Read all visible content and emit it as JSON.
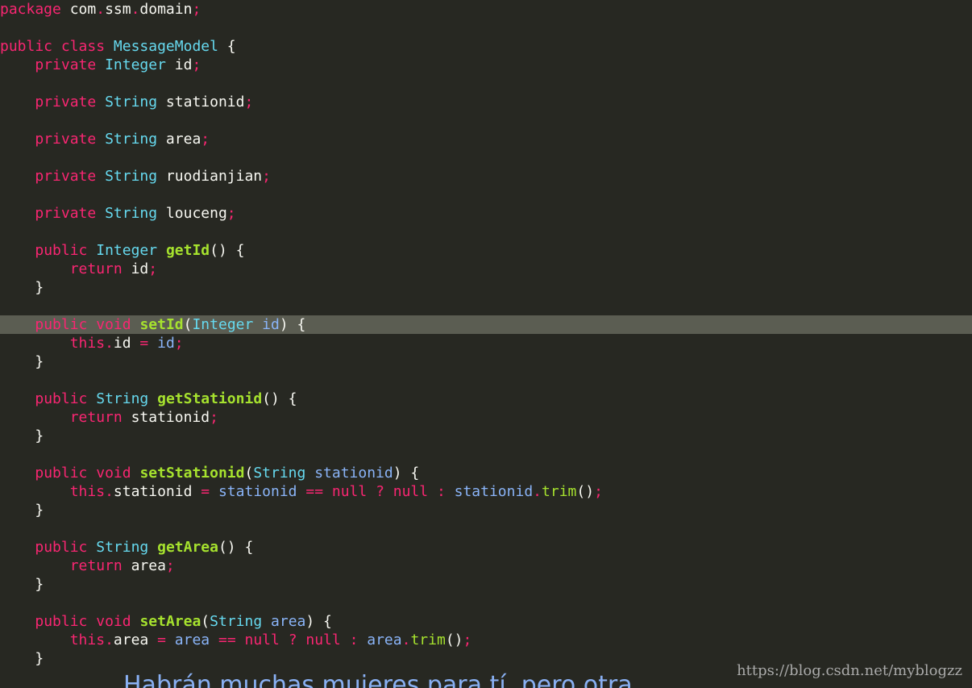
{
  "editor": {
    "theme": {
      "background": "#272822",
      "highlight_line_bg": "#5b5d52",
      "keyword": "#f92672",
      "type": "#66d9ef",
      "function": "#a6e22e",
      "param": "#8ab4f8",
      "text": "#f8f8f2"
    },
    "highlighted_line_index": 17,
    "lines": [
      [
        {
          "t": "package",
          "k": "kw"
        },
        {
          "t": " com",
          "k": "text"
        },
        {
          "t": ".",
          "k": "punct"
        },
        {
          "t": "ssm",
          "k": "text"
        },
        {
          "t": ".",
          "k": "punct"
        },
        {
          "t": "domain",
          "k": "text"
        },
        {
          "t": ";",
          "k": "punct"
        }
      ],
      [],
      [
        {
          "t": "public",
          "k": "kw"
        },
        {
          "t": " ",
          "k": "text"
        },
        {
          "t": "class",
          "k": "kw"
        },
        {
          "t": " ",
          "k": "text"
        },
        {
          "t": "MessageModel",
          "k": "type"
        },
        {
          "t": " {",
          "k": "text"
        }
      ],
      [
        {
          "t": "    ",
          "k": "text"
        },
        {
          "t": "private",
          "k": "kw"
        },
        {
          "t": " ",
          "k": "text"
        },
        {
          "t": "Integer",
          "k": "type"
        },
        {
          "t": " id",
          "k": "text"
        },
        {
          "t": ";",
          "k": "punct"
        }
      ],
      [],
      [
        {
          "t": "    ",
          "k": "text"
        },
        {
          "t": "private",
          "k": "kw"
        },
        {
          "t": " ",
          "k": "text"
        },
        {
          "t": "String",
          "k": "type"
        },
        {
          "t": " stationid",
          "k": "text"
        },
        {
          "t": ";",
          "k": "punct"
        }
      ],
      [],
      [
        {
          "t": "    ",
          "k": "text"
        },
        {
          "t": "private",
          "k": "kw"
        },
        {
          "t": " ",
          "k": "text"
        },
        {
          "t": "String",
          "k": "type"
        },
        {
          "t": " area",
          "k": "text"
        },
        {
          "t": ";",
          "k": "punct"
        }
      ],
      [],
      [
        {
          "t": "    ",
          "k": "text"
        },
        {
          "t": "private",
          "k": "kw"
        },
        {
          "t": " ",
          "k": "text"
        },
        {
          "t": "String",
          "k": "type"
        },
        {
          "t": " ruodianjian",
          "k": "text"
        },
        {
          "t": ";",
          "k": "punct"
        }
      ],
      [],
      [
        {
          "t": "    ",
          "k": "text"
        },
        {
          "t": "private",
          "k": "kw"
        },
        {
          "t": " ",
          "k": "text"
        },
        {
          "t": "String",
          "k": "type"
        },
        {
          "t": " louceng",
          "k": "text"
        },
        {
          "t": ";",
          "k": "punct"
        }
      ],
      [],
      [
        {
          "t": "    ",
          "k": "text"
        },
        {
          "t": "public",
          "k": "kw"
        },
        {
          "t": " ",
          "k": "text"
        },
        {
          "t": "Integer",
          "k": "type"
        },
        {
          "t": " ",
          "k": "text"
        },
        {
          "t": "getId",
          "k": "fn"
        },
        {
          "t": "() {",
          "k": "text"
        }
      ],
      [
        {
          "t": "        ",
          "k": "text"
        },
        {
          "t": "return",
          "k": "kw"
        },
        {
          "t": " id",
          "k": "text"
        },
        {
          "t": ";",
          "k": "punct"
        }
      ],
      [
        {
          "t": "    }",
          "k": "text"
        }
      ],
      [],
      [
        {
          "t": "    ",
          "k": "text"
        },
        {
          "t": "public",
          "k": "kw"
        },
        {
          "t": " ",
          "k": "text"
        },
        {
          "t": "void",
          "k": "kw"
        },
        {
          "t": " ",
          "k": "text"
        },
        {
          "t": "setId",
          "k": "fn"
        },
        {
          "t": "(",
          "k": "text"
        },
        {
          "t": "Integer",
          "k": "type"
        },
        {
          "t": " ",
          "k": "text"
        },
        {
          "t": "id",
          "k": "param"
        },
        {
          "t": ") {",
          "k": "text"
        }
      ],
      [
        {
          "t": "        ",
          "k": "text"
        },
        {
          "t": "this",
          "k": "kw"
        },
        {
          "t": ".",
          "k": "punct"
        },
        {
          "t": "id",
          "k": "text"
        },
        {
          "t": " = ",
          "k": "punct"
        },
        {
          "t": "id",
          "k": "param"
        },
        {
          "t": ";",
          "k": "punct"
        }
      ],
      [
        {
          "t": "    }",
          "k": "text"
        }
      ],
      [],
      [
        {
          "t": "    ",
          "k": "text"
        },
        {
          "t": "public",
          "k": "kw"
        },
        {
          "t": " ",
          "k": "text"
        },
        {
          "t": "String",
          "k": "type"
        },
        {
          "t": " ",
          "k": "text"
        },
        {
          "t": "getStationid",
          "k": "fn"
        },
        {
          "t": "() {",
          "k": "text"
        }
      ],
      [
        {
          "t": "        ",
          "k": "text"
        },
        {
          "t": "return",
          "k": "kw"
        },
        {
          "t": " stationid",
          "k": "text"
        },
        {
          "t": ";",
          "k": "punct"
        }
      ],
      [
        {
          "t": "    }",
          "k": "text"
        }
      ],
      [],
      [
        {
          "t": "    ",
          "k": "text"
        },
        {
          "t": "public",
          "k": "kw"
        },
        {
          "t": " ",
          "k": "text"
        },
        {
          "t": "void",
          "k": "kw"
        },
        {
          "t": " ",
          "k": "text"
        },
        {
          "t": "setStationid",
          "k": "fn"
        },
        {
          "t": "(",
          "k": "text"
        },
        {
          "t": "String",
          "k": "type"
        },
        {
          "t": " ",
          "k": "text"
        },
        {
          "t": "stationid",
          "k": "param"
        },
        {
          "t": ") {",
          "k": "text"
        }
      ],
      [
        {
          "t": "        ",
          "k": "text"
        },
        {
          "t": "this",
          "k": "kw"
        },
        {
          "t": ".",
          "k": "punct"
        },
        {
          "t": "stationid",
          "k": "text"
        },
        {
          "t": " = ",
          "k": "punct"
        },
        {
          "t": "stationid",
          "k": "param"
        },
        {
          "t": " == ",
          "k": "punct"
        },
        {
          "t": "null",
          "k": "kw"
        },
        {
          "t": " ? ",
          "k": "punct"
        },
        {
          "t": "null",
          "k": "kw"
        },
        {
          "t": " : ",
          "k": "punct"
        },
        {
          "t": "stationid",
          "k": "param"
        },
        {
          "t": ".",
          "k": "punct"
        },
        {
          "t": "trim",
          "k": "call"
        },
        {
          "t": "()",
          "k": "text"
        },
        {
          "t": ";",
          "k": "punct"
        }
      ],
      [
        {
          "t": "    }",
          "k": "text"
        }
      ],
      [],
      [
        {
          "t": "    ",
          "k": "text"
        },
        {
          "t": "public",
          "k": "kw"
        },
        {
          "t": " ",
          "k": "text"
        },
        {
          "t": "String",
          "k": "type"
        },
        {
          "t": " ",
          "k": "text"
        },
        {
          "t": "getArea",
          "k": "fn"
        },
        {
          "t": "() {",
          "k": "text"
        }
      ],
      [
        {
          "t": "        ",
          "k": "text"
        },
        {
          "t": "return",
          "k": "kw"
        },
        {
          "t": " area",
          "k": "text"
        },
        {
          "t": ";",
          "k": "punct"
        }
      ],
      [
        {
          "t": "    }",
          "k": "text"
        }
      ],
      [],
      [
        {
          "t": "    ",
          "k": "text"
        },
        {
          "t": "public",
          "k": "kw"
        },
        {
          "t": " ",
          "k": "text"
        },
        {
          "t": "void",
          "k": "kw"
        },
        {
          "t": " ",
          "k": "text"
        },
        {
          "t": "setArea",
          "k": "fn"
        },
        {
          "t": "(",
          "k": "text"
        },
        {
          "t": "String",
          "k": "type"
        },
        {
          "t": " ",
          "k": "text"
        },
        {
          "t": "area",
          "k": "param"
        },
        {
          "t": ") {",
          "k": "text"
        }
      ],
      [
        {
          "t": "        ",
          "k": "text"
        },
        {
          "t": "this",
          "k": "kw"
        },
        {
          "t": ".",
          "k": "punct"
        },
        {
          "t": "area",
          "k": "text"
        },
        {
          "t": " = ",
          "k": "punct"
        },
        {
          "t": "area",
          "k": "param"
        },
        {
          "t": " == ",
          "k": "punct"
        },
        {
          "t": "null",
          "k": "kw"
        },
        {
          "t": " ? ",
          "k": "punct"
        },
        {
          "t": "null",
          "k": "kw"
        },
        {
          "t": " : ",
          "k": "punct"
        },
        {
          "t": "area",
          "k": "param"
        },
        {
          "t": ".",
          "k": "punct"
        },
        {
          "t": "trim",
          "k": "call"
        },
        {
          "t": "()",
          "k": "text"
        },
        {
          "t": ";",
          "k": "punct"
        }
      ],
      [
        {
          "t": "    }",
          "k": "text"
        }
      ]
    ]
  },
  "watermark": "https://blog.csdn.net/myblogzz",
  "caption": "Habrán muchas mujeres para tí, pero otra"
}
